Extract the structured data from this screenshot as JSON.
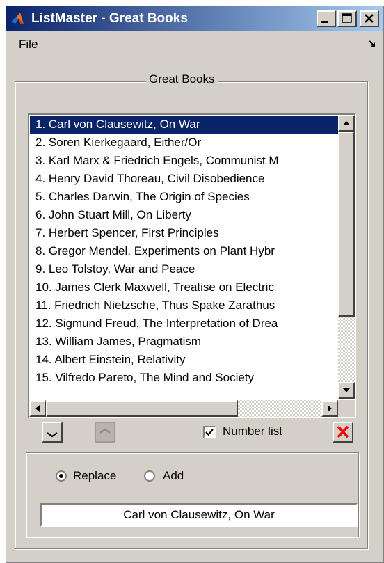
{
  "window": {
    "title": "ListMaster - Great Books"
  },
  "menu": {
    "file_label": "File"
  },
  "group": {
    "title": "Great Books"
  },
  "list": {
    "selected_index": 0,
    "items": [
      "1. Carl von Clausewitz, On War",
      "2. Soren Kierkegaard, Either/Or",
      "3. Karl Marx & Friedrich Engels, Communist M",
      "4. Henry David Thoreau, Civil Disobedience",
      "5. Charles Darwin, The Origin of Species",
      "6. John Stuart Mill, On Liberty",
      "7. Herbert Spencer, First Principles",
      "8. Gregor Mendel, Experiments on Plant Hybr",
      "9. Leo Tolstoy, War and Peace",
      "10. James Clerk Maxwell, Treatise on Electric",
      "11. Friedrich Nietzsche, Thus Spake Zarathus",
      "12. Sigmund Freud, The Interpretation of Drea",
      "13. William James, Pragmatism",
      "14. Albert Einstein, Relativity",
      "15. Vilfredo Pareto, The Mind and Society"
    ]
  },
  "controls": {
    "number_list_label": "Number list",
    "number_list_checked": true
  },
  "mode": {
    "replace_label": "Replace",
    "add_label": "Add",
    "selected": "Replace"
  },
  "entry": {
    "value": "Carl von Clausewitz, On War"
  },
  "colors": {
    "title_start": "#0a246a",
    "title_end": "#a6caf0",
    "selection": "#0a246a",
    "face": "#d4d0c8",
    "delete_red": "#ff0000"
  }
}
